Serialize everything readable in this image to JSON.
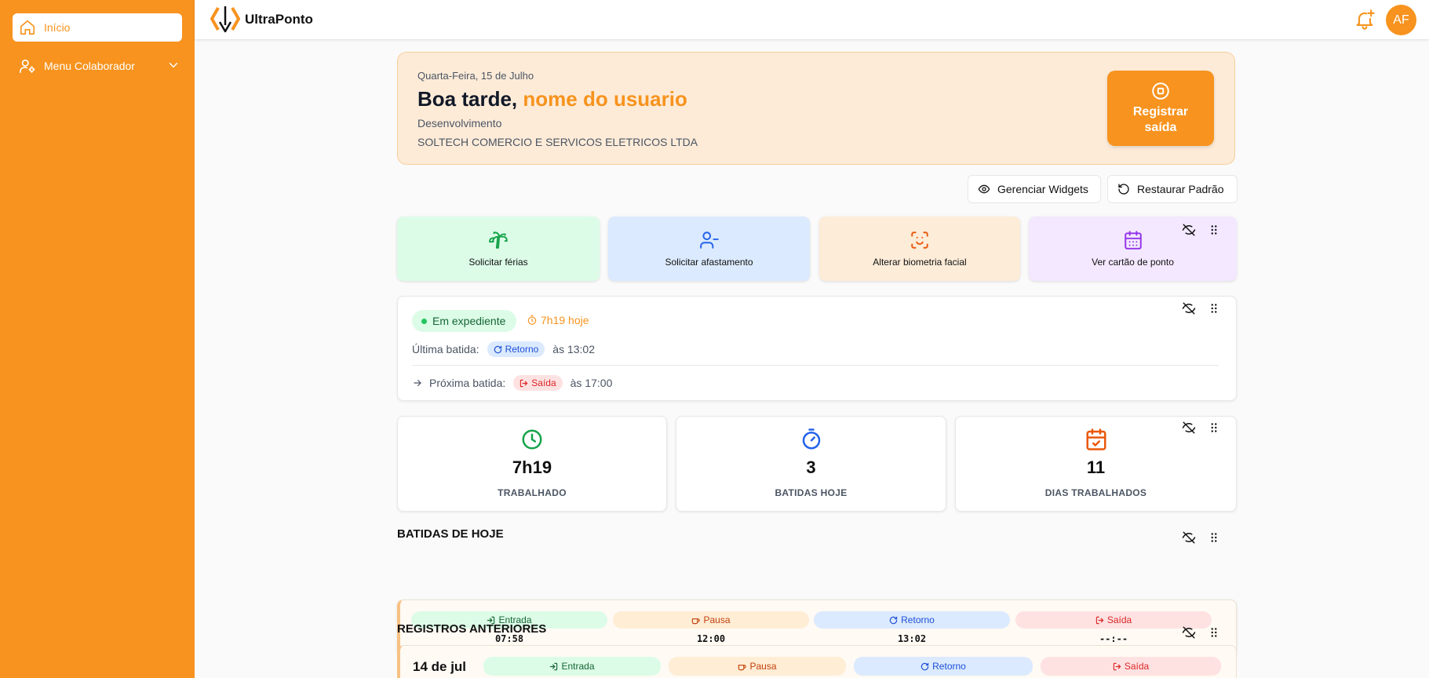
{
  "sidebar": {
    "items": [
      {
        "label": "Início",
        "icon": "home-icon"
      },
      {
        "label": "Menu Colaborador",
        "icon": "user-gear-icon"
      }
    ]
  },
  "topbar": {
    "brand": "UltraPonto",
    "avatar_initials": "AF"
  },
  "greeting": {
    "date": "Quarta-Feira, 15 de Julho",
    "hello": "Boa tarde,",
    "name": "nome do usuario",
    "department": "Desenvolvimento",
    "company": "SOLTECH COMERCIO E SERVICOS ELETRICOS LTDA",
    "register_line1": "Registrar",
    "register_line2": "saída"
  },
  "toolbar": {
    "manage_widgets": "Gerenciar Widgets",
    "restore_default": "Restaurar Padrão"
  },
  "quick_actions": [
    {
      "label": "Solicitar férias",
      "icon": "palm-tree-icon"
    },
    {
      "label": "Solicitar afastamento",
      "icon": "user-minus-icon"
    },
    {
      "label": "Alterar biometria facial",
      "icon": "face-scan-icon"
    },
    {
      "label": "Ver cartão de ponto",
      "icon": "calendar-icon"
    }
  ],
  "status": {
    "state": "Em expediente",
    "worked_today": "7h19 hoje",
    "last_label": "Última batida:",
    "last_type": "Retorno",
    "last_time": "às 13:02",
    "next_label": "Próxima batida:",
    "next_type": "Saída",
    "next_time": "às 17:00"
  },
  "stats": [
    {
      "value": "7h19",
      "label": "TRABALHADO"
    },
    {
      "value": "3",
      "label": "BATIDAS HOJE"
    },
    {
      "value": "11",
      "label": "DIAS TRABALHADOS"
    }
  ],
  "today": {
    "title": "BATIDAS DE HOJE",
    "punches": [
      {
        "type": "Entrada",
        "time": "07:58"
      },
      {
        "type": "Pausa",
        "time": "12:00"
      },
      {
        "type": "Retorno",
        "time": "13:02"
      },
      {
        "type": "Saída",
        "time": "--:--"
      }
    ]
  },
  "previous": {
    "title": "REGISTROS ANTERIORES",
    "date": "14 de jul",
    "punches": [
      {
        "type": "Entrada"
      },
      {
        "type": "Pausa"
      },
      {
        "type": "Retorno"
      },
      {
        "type": "Saída"
      }
    ]
  },
  "colors": {
    "brand": "#f7931e",
    "green": "#16a34a",
    "blue": "#2563eb",
    "red": "#dc2626",
    "purple": "#9333ea"
  }
}
